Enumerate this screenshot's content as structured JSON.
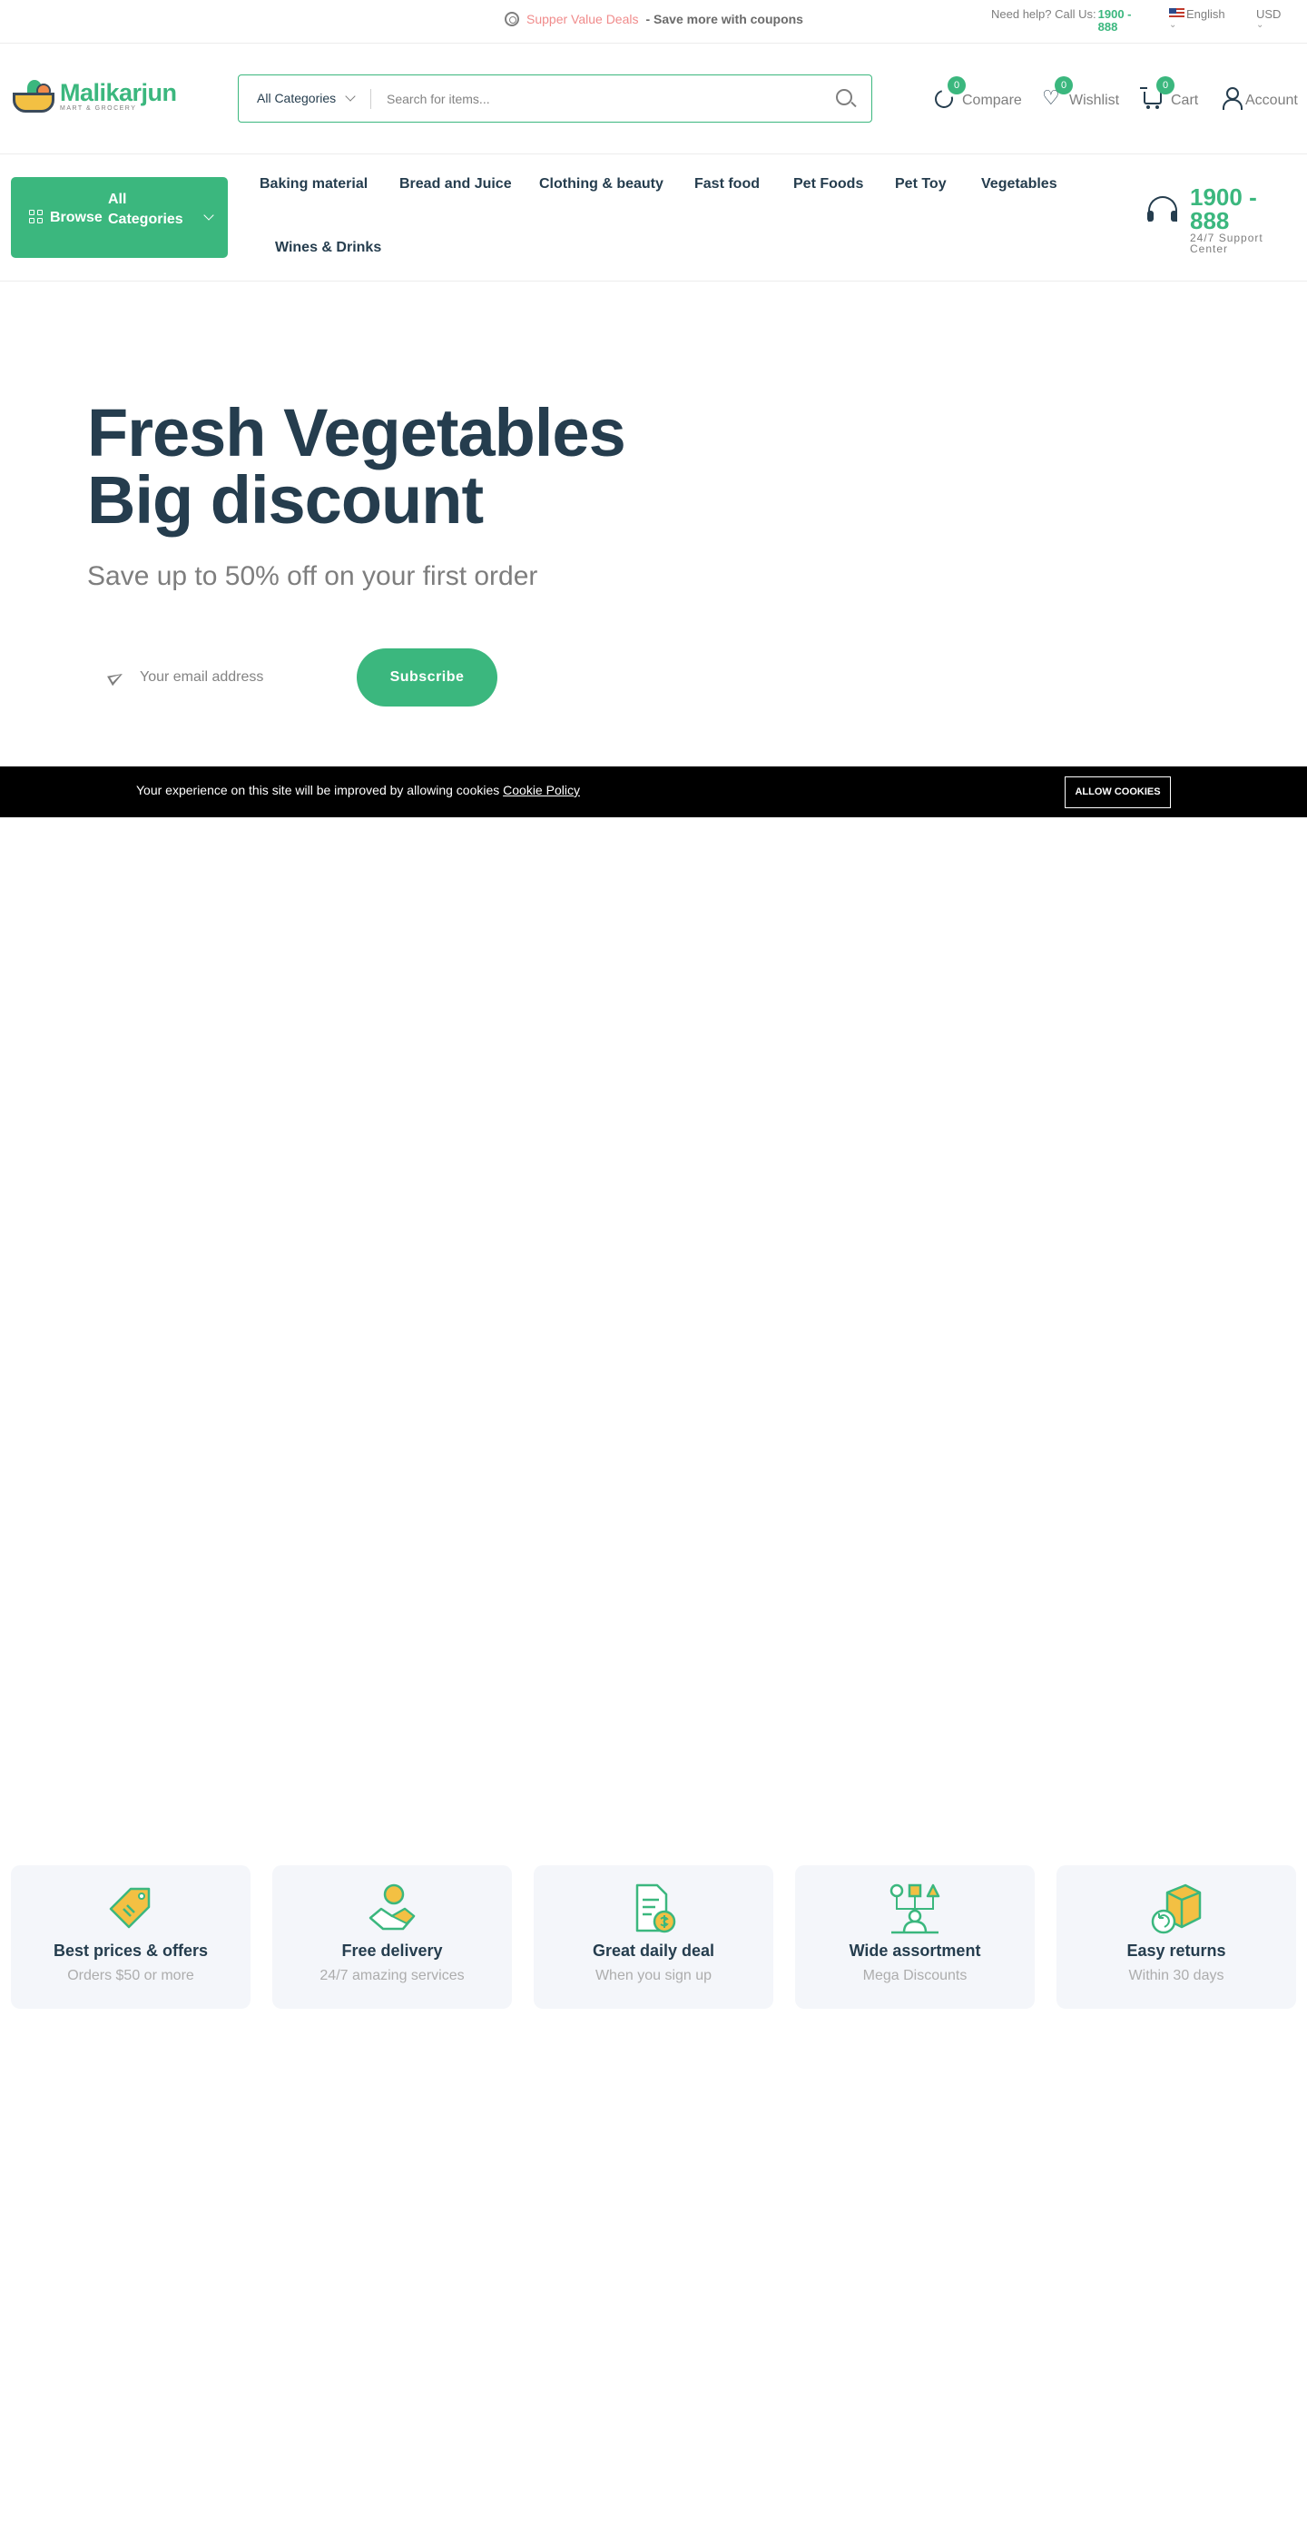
{
  "topbar": {
    "promo_highlight": "Supper Value Deals",
    "promo_text": " - Save more with coupons",
    "help_label": "Need help? Call Us:",
    "help_phone": "1900 - 888",
    "language": "English",
    "currency": "USD"
  },
  "header": {
    "logo_name": "Malikarjun",
    "logo_tagline": "MART & GROCERY",
    "search": {
      "category": "All Categories",
      "placeholder": "Search for items..."
    },
    "actions": [
      {
        "label": "Compare",
        "count": "0",
        "icon": "compare-icon"
      },
      {
        "label": "Wishlist",
        "count": "0",
        "icon": "heart-icon"
      },
      {
        "label": "Cart",
        "count": "0",
        "icon": "cart-icon"
      },
      {
        "label": "Account",
        "icon": "user-icon"
      }
    ]
  },
  "nav": {
    "browse_prefix": "Browse",
    "browse_label": "All Categories",
    "links": [
      "Baking material",
      "Bread and Juice",
      "Clothing & beauty",
      "Fast food",
      "Pet Foods",
      "Pet Toy",
      "Vegetables",
      "Wines & Drinks"
    ],
    "support_number": "1900 - 888",
    "support_label": "24/7 Support Center"
  },
  "hero": {
    "title_line1": "Fresh Vegetables",
    "title_line2": "Big discount",
    "subtitle": "Save up to 50% off on your first order",
    "email_placeholder": "Your email address",
    "subscribe_label": "Subscribe"
  },
  "cookie": {
    "message": "Your experience on this site will be improved by allowing cookies ",
    "policy_link": "Cookie Policy",
    "allow_label": "ALLOW COOKIES"
  },
  "features": [
    {
      "title": "Best prices & offers",
      "subtitle": "Orders $50 or more",
      "icon": "price-tag-icon"
    },
    {
      "title": "Free delivery",
      "subtitle": "24/7 amazing services",
      "icon": "delivery-icon"
    },
    {
      "title": "Great daily deal",
      "subtitle": "When you sign up",
      "icon": "daily-deal-icon"
    },
    {
      "title": "Wide assortment",
      "subtitle": "Mega Discounts",
      "icon": "assortment-icon"
    },
    {
      "title": "Easy returns",
      "subtitle": "Within 30 days",
      "icon": "returns-icon"
    }
  ],
  "colors": {
    "brand": "#3bb77e",
    "heading": "#253d4e",
    "muted": "#7e7e7e",
    "promo": "#f08b8b",
    "feature_bg": "#f4f6fa",
    "accent_yellow": "#f3c043"
  }
}
